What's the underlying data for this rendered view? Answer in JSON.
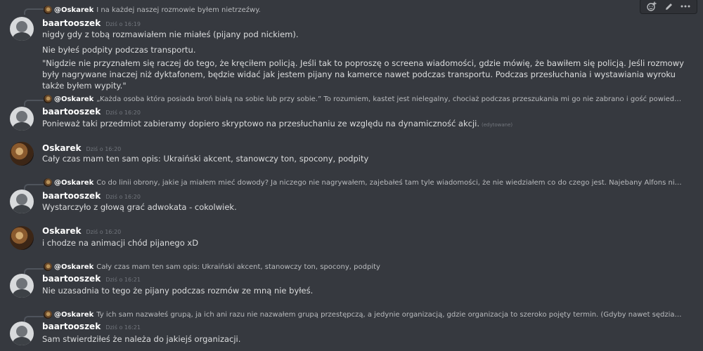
{
  "toolbar": {
    "reaction_icon": "add-reaction-icon",
    "edit_icon": "pencil-icon",
    "more_icon": "more-icon"
  },
  "messages": [
    {
      "reply": {
        "name": "@Oskarek",
        "text": "I na każdej naszej rozmowie byłem nietrzeźwy."
      },
      "author": "baartooszek",
      "timestamp": "Dziś o 16:19",
      "lines": [
        "nigdy gdy z tobą rozmawiałem nie miałeś (pijany pod nickiem).",
        "Nie byłeś podpity podczas transportu.",
        "\"Nigdzie nie przyznałem się raczej do tego, że kręciłem policją. Jeśli tak to poproszę o screena wiadomości, gdzie mówię, że bawiłem się policją. Jeśli rozmowy były nagrywane inaczej niż dyktafonem, będzie widać jak jestem pijany na kamerce nawet podczas transportu. Podczas przesłuchania i wystawiania wyroku także byłem wypity.\""
      ]
    },
    {
      "reply": {
        "name": "@Oskarek",
        "text": "„Każda osoba która posiada broń białą na sobie lub przy sobie.” To rozumiem, kastet jest nielegalny, chociaż podczas przeszukania mi go nie zabrano i gość powiedział, że nie mam br..."
      },
      "author": "baartooszek",
      "timestamp": "Dziś o 16:20",
      "lines": [
        "Ponieważ taki przedmiot zabieramy dopiero skryptowo na przesłuchaniu ze względu na dynamiczność akcji."
      ],
      "edited": "(edytowane)"
    },
    {
      "author": "Oskarek",
      "timestamp": "Dziś o 16:20",
      "lines": [
        "Cały czas mam ten sam opis: Ukraiński akcent, stanowczy ton, spocony, podpity"
      ]
    },
    {
      "reply": {
        "name": "@Oskarek",
        "text": "Co do linii obrony, jakie ja miałem mieć dowody? Ja niczego nie nagrywałem, zajebałeś tam tyle wiadomości, że nie wiedziałem co do czego jest. Najebany Alfons nie nagrywa rozmów..."
      },
      "author": "baartooszek",
      "timestamp": "Dziś o 16:20",
      "lines": [
        "Wystarczyło z głową grać adwokata - cokolwiek."
      ]
    },
    {
      "author": "Oskarek",
      "timestamp": "Dziś o 16:20",
      "lines": [
        "i chodze na animacji chód pijanego xD"
      ]
    },
    {
      "reply": {
        "name": "@Oskarek",
        "text": "Cały czas mam ten sam opis: Ukraiński akcent, stanowczy ton, spocony, podpity"
      },
      "author": "baartooszek",
      "timestamp": "Dziś o 16:21",
      "lines": [
        "Nie uzasadnia to tego że pijany podczas rozmów ze mną nie byłeś."
      ]
    },
    {
      "reply": {
        "name": "@Oskarek",
        "text": "Ty ich sam nazwałeś grupą, ja ich ani razu nie nazwałem grupą przestępczą, a jedynie organizacją, gdzie organizacja to szeroko pojęty termin. (Gdyby nawet sędzia zapytał w jakim se..."
      },
      "author": "baartooszek",
      "timestamp": "Dziś o 16:21",
      "lines": [
        "Sam stwierdziłeś że należa do jakiejś organizacji."
      ]
    }
  ]
}
